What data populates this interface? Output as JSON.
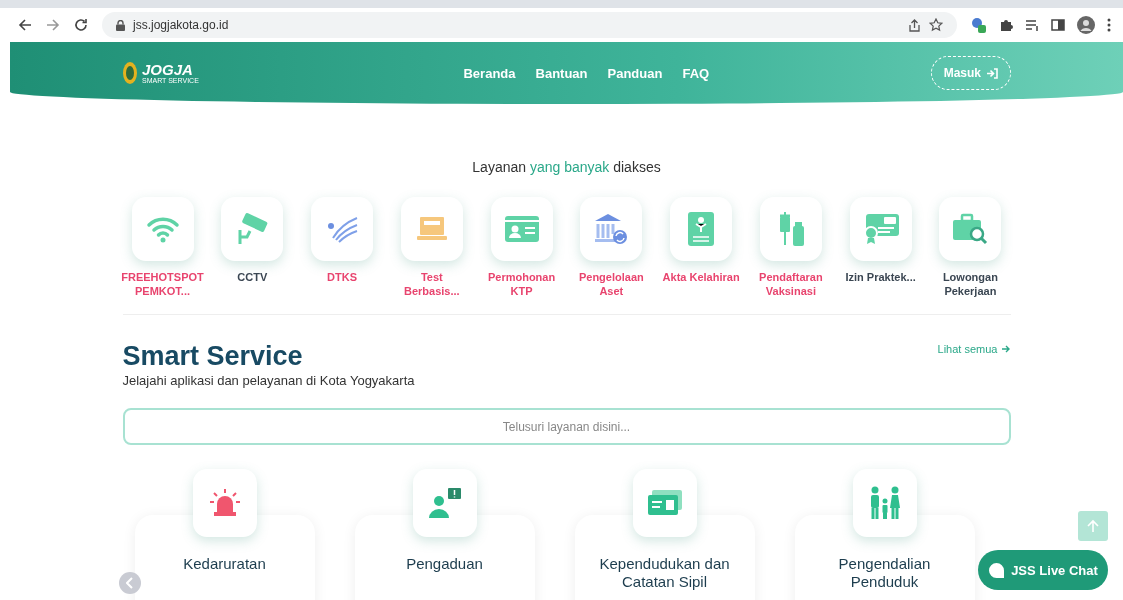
{
  "browser": {
    "url": "jss.jogjakota.go.id"
  },
  "header": {
    "logo_title": "JOGJA",
    "logo_subtitle": "SMART SERVICE",
    "nav": [
      {
        "label": "Beranda"
      },
      {
        "label": "Bantuan"
      },
      {
        "label": "Panduan"
      },
      {
        "label": "FAQ"
      }
    ],
    "login_button": "Masuk"
  },
  "popular": {
    "heading": [
      {
        "text": "Layanan",
        "highlighted": false
      },
      {
        "text": "yang banyak",
        "highlighted": true
      },
      {
        "text": "diakses",
        "highlighted": false
      }
    ],
    "items": [
      {
        "label": "FREEHOTSPOT PEMKOT...",
        "color": "#e8446e"
      },
      {
        "label": "CCTV",
        "color": "#3a4652"
      },
      {
        "label": "DTKS",
        "color": "#e8446e"
      },
      {
        "label": "Test Berbasis...",
        "color": "#e8446e"
      },
      {
        "label": "Permohonan KTP",
        "color": "#e8446e"
      },
      {
        "label": "Pengelolaan Aset",
        "color": "#e8446e"
      },
      {
        "label": "Akta Kelahiran",
        "color": "#e8446e"
      },
      {
        "label": "Pendaftaran Vaksinasi",
        "color": "#e8446e"
      },
      {
        "label": "Izin Praktek...",
        "color": "#3a4652"
      },
      {
        "label": "Lowongan Pekerjaan",
        "color": "#3a4652"
      }
    ]
  },
  "smart_service": {
    "title": "Smart Service",
    "subtitle": "Jelajahi aplikasi dan pelayanan di Kota Yogyakarta",
    "see_all": "Lihat semua",
    "search_placeholder": "Telusuri layanan disini...",
    "categories": [
      {
        "label": "Kedaruratan"
      },
      {
        "label": "Pengaduan"
      },
      {
        "label": "Kependudukan dan Catatan Sipil"
      },
      {
        "label": "Pengendalian Penduduk"
      }
    ]
  },
  "live_chat": {
    "label": "JSS Live Chat"
  }
}
